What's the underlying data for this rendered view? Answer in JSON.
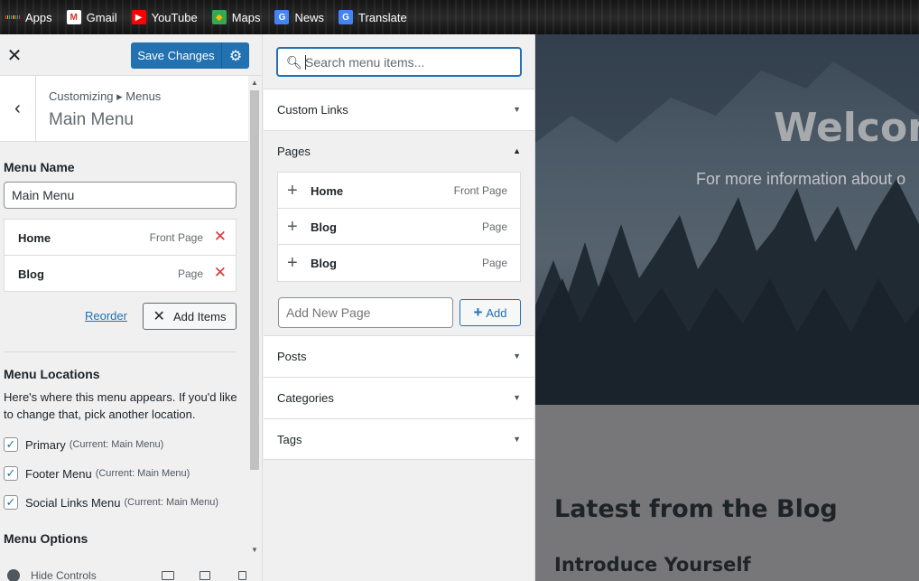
{
  "bookmarks": [
    {
      "label": "Apps",
      "icon": "apps-grid-icon"
    },
    {
      "label": "Gmail",
      "icon": "gmail-icon"
    },
    {
      "label": "YouTube",
      "icon": "youtube-icon"
    },
    {
      "label": "Maps",
      "icon": "maps-icon"
    },
    {
      "label": "News",
      "icon": "news-icon"
    },
    {
      "label": "Translate",
      "icon": "translate-icon"
    }
  ],
  "header": {
    "close_glyph": "✕",
    "save_label": "Save Changes",
    "gear_glyph": "⚙"
  },
  "section": {
    "back_glyph": "‹",
    "breadcrumb": "Customizing ▸ Menus",
    "title": "Main Menu"
  },
  "menu": {
    "name_label": "Menu Name",
    "name_value": "Main Menu",
    "items": [
      {
        "title": "Home",
        "type": "Front Page"
      },
      {
        "title": "Blog",
        "type": "Page"
      }
    ],
    "remove_glyph": "✕",
    "reorder_label": "Reorder",
    "add_items_label": "Add Items",
    "locations_label": "Menu Locations",
    "locations_desc": "Here's where this menu appears. If you'd like to change that, pick another location.",
    "locations": [
      {
        "label": "Primary",
        "note": "(Current: Main Menu)",
        "checked": true
      },
      {
        "label": "Footer Menu",
        "note": "(Current: Main Menu)",
        "checked": true
      },
      {
        "label": "Social Links Menu",
        "note": "(Current: Main Menu)",
        "checked": true
      }
    ],
    "options_label": "Menu Options"
  },
  "footer": {
    "hide_controls": "Hide Controls"
  },
  "add_panel": {
    "search_placeholder": "Search menu items...",
    "sections": [
      {
        "title": "Custom Links",
        "expanded": false
      },
      {
        "title": "Pages",
        "expanded": true
      },
      {
        "title": "Posts",
        "expanded": false
      },
      {
        "title": "Categories",
        "expanded": false
      },
      {
        "title": "Tags",
        "expanded": false
      }
    ],
    "pages": [
      {
        "title": "Home",
        "type": "Front Page"
      },
      {
        "title": "Blog",
        "type": "Page"
      },
      {
        "title": "Blog",
        "type": "Page"
      }
    ],
    "new_page_placeholder": "Add New Page",
    "add_label": "Add"
  },
  "preview": {
    "welcome": "Welcome",
    "subline": "For more information about o",
    "latest": "Latest from the Blog",
    "post_title": "Introduce Yourself"
  },
  "colors": {
    "accent": "#2271b1",
    "danger": "#d63638"
  }
}
